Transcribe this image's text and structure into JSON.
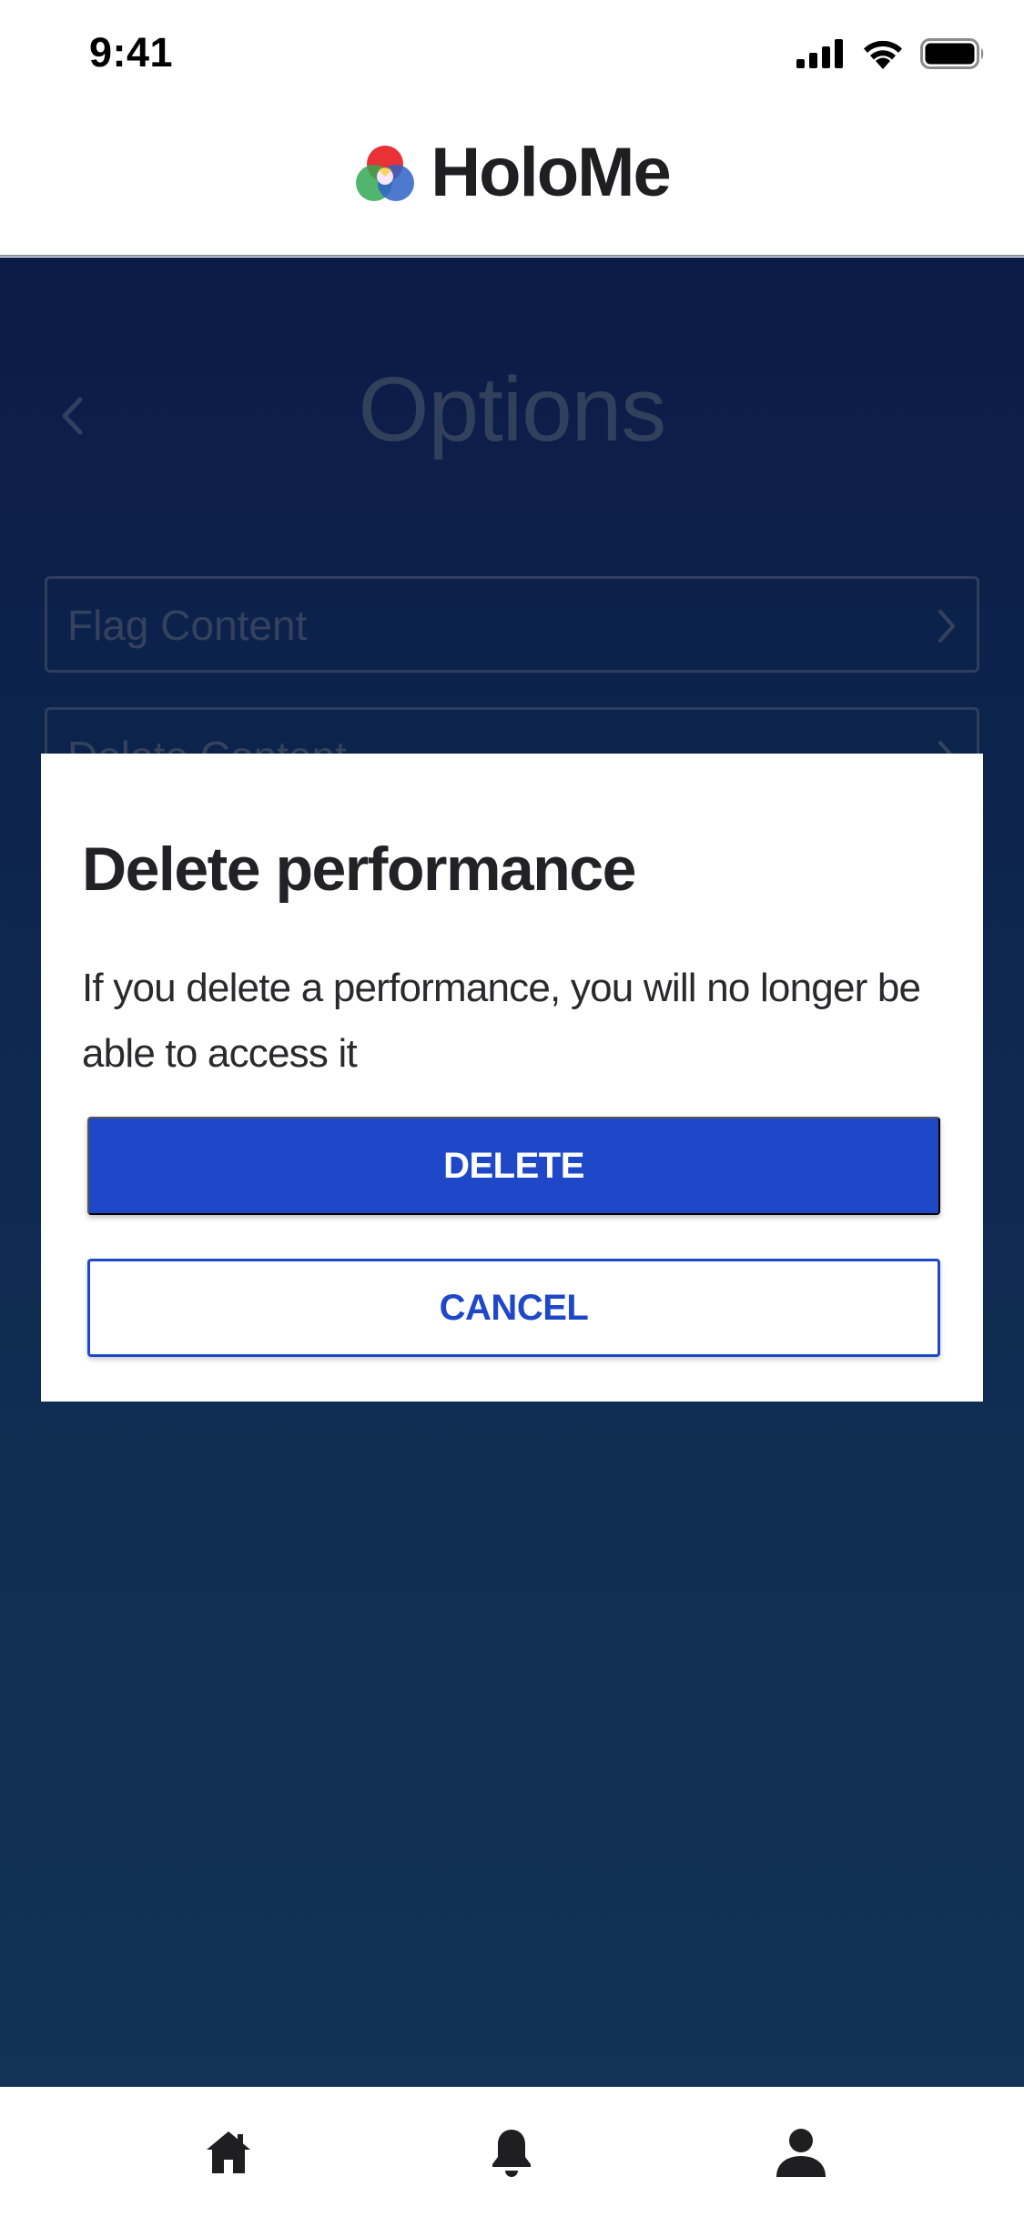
{
  "status_bar": {
    "time": "9:41"
  },
  "header": {
    "brand_name": "HoloMe"
  },
  "background_screen": {
    "title": "Options",
    "options": [
      {
        "label": "Flag Content"
      },
      {
        "label": "Delete Content"
      }
    ]
  },
  "dialog": {
    "title": "Delete performance",
    "message": "If you delete a performance, you will no longer be able to access it",
    "delete_label": "DELETE",
    "cancel_label": "CANCEL"
  },
  "tab_bar": {
    "items": [
      {
        "icon": "home-icon"
      },
      {
        "icon": "bell-icon"
      },
      {
        "icon": "user-icon"
      }
    ]
  },
  "colors": {
    "accent": "#1f48c9",
    "background_top": "#0c1d4e",
    "background_bottom": "#143a5e"
  }
}
